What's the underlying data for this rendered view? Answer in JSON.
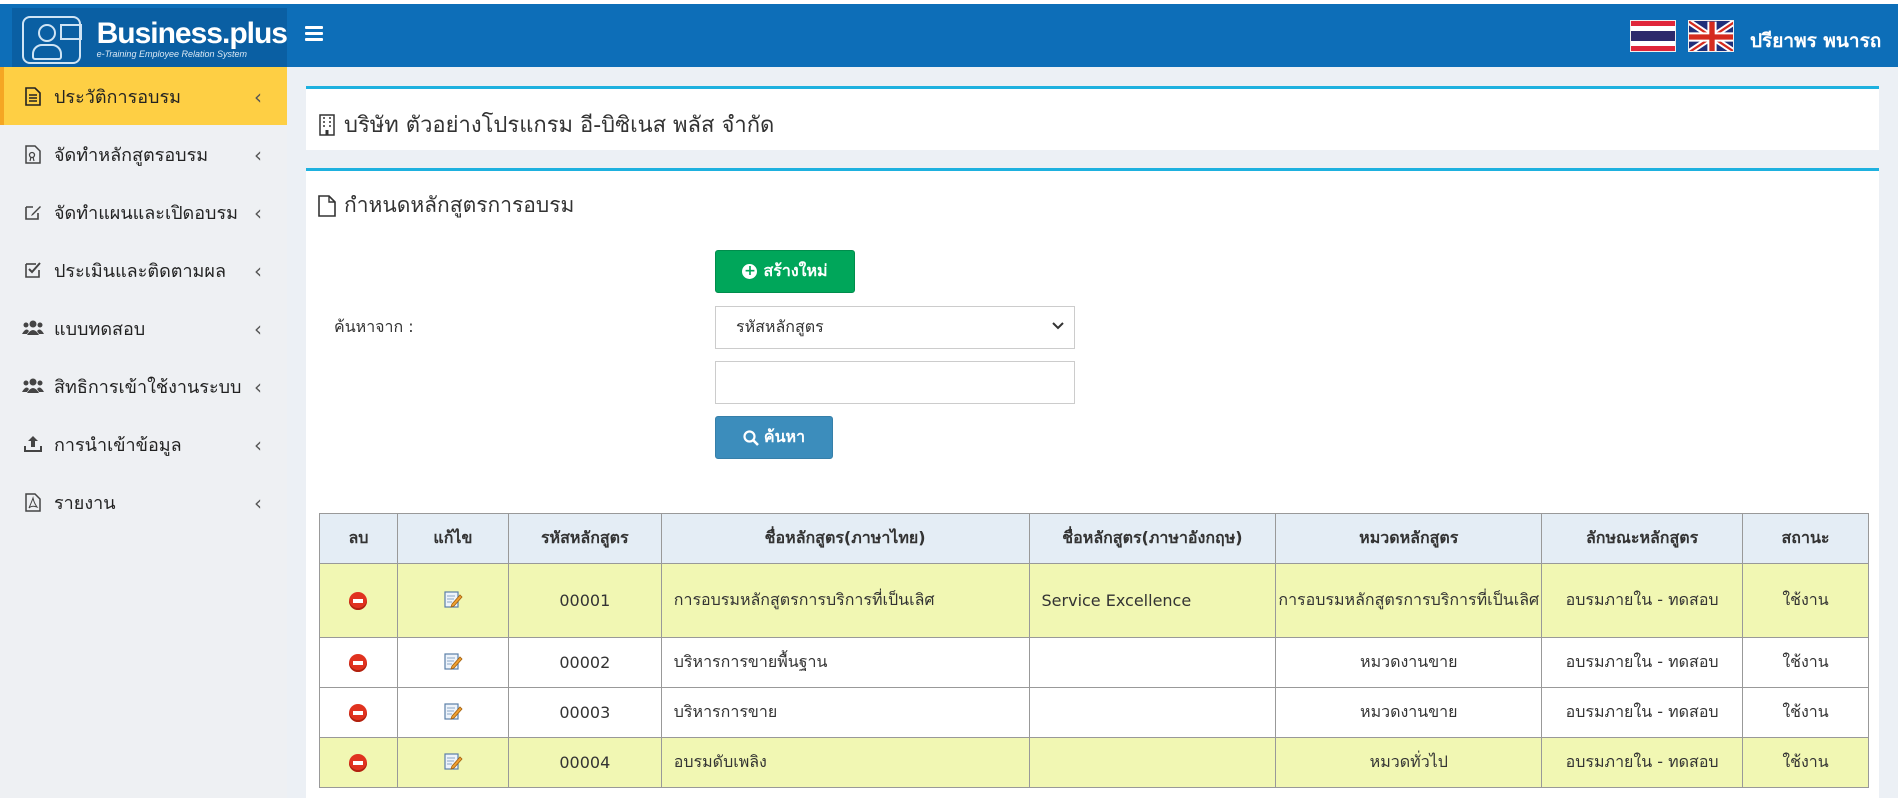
{
  "header": {
    "logo_main": "Business.plus",
    "logo_sub": "e-Training Employee Relation System",
    "user_name": "ปรียาพร พนารถ",
    "brand_color": "#0d6eb8"
  },
  "sidebar": {
    "items": [
      {
        "label": "ประวัติการอบรม",
        "icon": "document-icon",
        "active": true
      },
      {
        "label": "จัดทำหลักสูตรอบรม",
        "icon": "file-certificate-icon"
      },
      {
        "label": "จัดทำแผนและเปิดอบรม",
        "icon": "edit-icon"
      },
      {
        "label": "ประเมินและติดตามผล",
        "icon": "check-square-icon"
      },
      {
        "label": "แบบทดสอบ",
        "icon": "users-icon"
      },
      {
        "label": "สิทธิการเข้าใช้งานระบบ",
        "icon": "users-icon"
      },
      {
        "label": "การนำเข้าข้อมูล",
        "icon": "upload-icon"
      },
      {
        "label": "รายงาน",
        "icon": "pdf-file-icon"
      }
    ]
  },
  "main": {
    "company_name": "บริษัท ตัวอย่างโปรแกรม อี-บิซิเนส พลัส จำกัด",
    "section_title": "กำหนดหลักสูตรการอบรม",
    "search_label": "ค้นหาจาก :",
    "create_button": "สร้างใหม่",
    "search_by_selected": "รหัสหลักสูตร",
    "search_value": "",
    "search_button": "ค้นหา"
  },
  "table": {
    "headers": [
      "ลบ",
      "แก้ไข",
      "รหัสหลักสูตร",
      "ชื่อหลักสูตร(ภาษาไทย)",
      "ชื่อหลักสูตร(ภาษาอังกฤษ)",
      "หมวดหลักสูตร",
      "ลักษณะหลักสูตร",
      "สถานะ"
    ],
    "rows": [
      {
        "code": "00001",
        "name_th": "การอบรมหลักสูตรการบริการที่เป็นเลิศ",
        "name_en": "Service Excellence",
        "category": "การอบรมหลักสูตรการบริการที่เป็นเลิศ",
        "type": "อบรมภายใน - ทดสอบ",
        "status": "ใช้งาน"
      },
      {
        "code": "00002",
        "name_th": "บริหารการขายพื้นฐาน",
        "name_en": "",
        "category": "หมวดงานขาย",
        "type": "อบรมภายใน - ทดสอบ",
        "status": "ใช้งาน"
      },
      {
        "code": "00003",
        "name_th": "บริหารการขาย",
        "name_en": "",
        "category": "หมวดงานขาย",
        "type": "อบรมภายใน - ทดสอบ",
        "status": "ใช้งาน"
      },
      {
        "code": "00004",
        "name_th": "อบรมดับเพลิง",
        "name_en": "",
        "category": "หมวดทั่วไป",
        "type": "อบรมภายใน - ทดสอบ",
        "status": "ใช้งาน"
      }
    ]
  }
}
